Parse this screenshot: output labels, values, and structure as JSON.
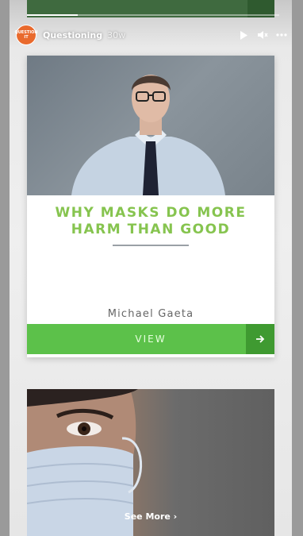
{
  "header": {
    "username": "Questioning",
    "time": "30w",
    "avatar_text": "QUESTION IT"
  },
  "story_progress": 0.2,
  "card": {
    "headline_line1": "WHY MASKS DO MORE",
    "headline_line2": "HARM THAN GOOD",
    "author": "Michael Gaeta",
    "view_label": "VIEW"
  },
  "see_more_label": "See More",
  "icons": {
    "play": "play-icon",
    "mute": "mute-icon",
    "more": "more-icon",
    "arrow": "arrow-right-icon",
    "chevron": "chevron-right-icon"
  },
  "colors": {
    "accent_green": "#5cc14a",
    "headline_green": "#86c44f",
    "avatar_orange": "#e96a2d"
  }
}
